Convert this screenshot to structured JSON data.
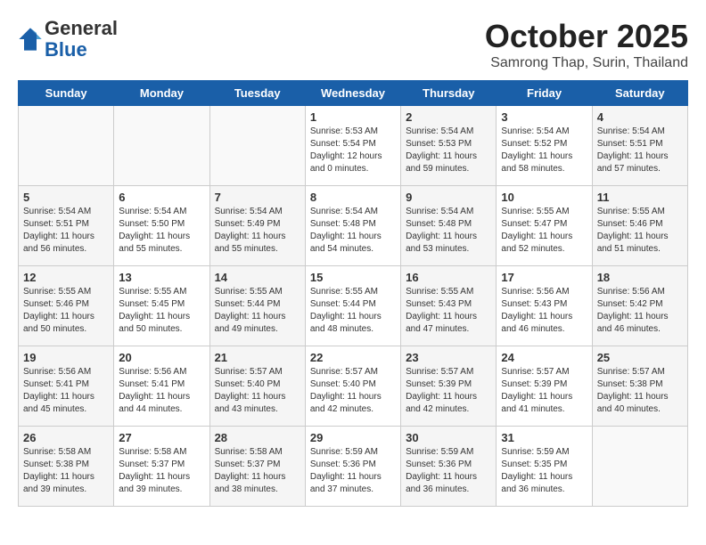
{
  "header": {
    "logo_line1": "General",
    "logo_line2": "Blue",
    "month": "October 2025",
    "location": "Samrong Thap, Surin, Thailand"
  },
  "weekdays": [
    "Sunday",
    "Monday",
    "Tuesday",
    "Wednesday",
    "Thursday",
    "Friday",
    "Saturday"
  ],
  "weeks": [
    [
      {
        "num": "",
        "info": ""
      },
      {
        "num": "",
        "info": ""
      },
      {
        "num": "",
        "info": ""
      },
      {
        "num": "1",
        "info": "Sunrise: 5:53 AM\nSunset: 5:54 PM\nDaylight: 12 hours\nand 0 minutes."
      },
      {
        "num": "2",
        "info": "Sunrise: 5:54 AM\nSunset: 5:53 PM\nDaylight: 11 hours\nand 59 minutes."
      },
      {
        "num": "3",
        "info": "Sunrise: 5:54 AM\nSunset: 5:52 PM\nDaylight: 11 hours\nand 58 minutes."
      },
      {
        "num": "4",
        "info": "Sunrise: 5:54 AM\nSunset: 5:51 PM\nDaylight: 11 hours\nand 57 minutes."
      }
    ],
    [
      {
        "num": "5",
        "info": "Sunrise: 5:54 AM\nSunset: 5:51 PM\nDaylight: 11 hours\nand 56 minutes."
      },
      {
        "num": "6",
        "info": "Sunrise: 5:54 AM\nSunset: 5:50 PM\nDaylight: 11 hours\nand 55 minutes."
      },
      {
        "num": "7",
        "info": "Sunrise: 5:54 AM\nSunset: 5:49 PM\nDaylight: 11 hours\nand 55 minutes."
      },
      {
        "num": "8",
        "info": "Sunrise: 5:54 AM\nSunset: 5:48 PM\nDaylight: 11 hours\nand 54 minutes."
      },
      {
        "num": "9",
        "info": "Sunrise: 5:54 AM\nSunset: 5:48 PM\nDaylight: 11 hours\nand 53 minutes."
      },
      {
        "num": "10",
        "info": "Sunrise: 5:55 AM\nSunset: 5:47 PM\nDaylight: 11 hours\nand 52 minutes."
      },
      {
        "num": "11",
        "info": "Sunrise: 5:55 AM\nSunset: 5:46 PM\nDaylight: 11 hours\nand 51 minutes."
      }
    ],
    [
      {
        "num": "12",
        "info": "Sunrise: 5:55 AM\nSunset: 5:46 PM\nDaylight: 11 hours\nand 50 minutes."
      },
      {
        "num": "13",
        "info": "Sunrise: 5:55 AM\nSunset: 5:45 PM\nDaylight: 11 hours\nand 50 minutes."
      },
      {
        "num": "14",
        "info": "Sunrise: 5:55 AM\nSunset: 5:44 PM\nDaylight: 11 hours\nand 49 minutes."
      },
      {
        "num": "15",
        "info": "Sunrise: 5:55 AM\nSunset: 5:44 PM\nDaylight: 11 hours\nand 48 minutes."
      },
      {
        "num": "16",
        "info": "Sunrise: 5:55 AM\nSunset: 5:43 PM\nDaylight: 11 hours\nand 47 minutes."
      },
      {
        "num": "17",
        "info": "Sunrise: 5:56 AM\nSunset: 5:43 PM\nDaylight: 11 hours\nand 46 minutes."
      },
      {
        "num": "18",
        "info": "Sunrise: 5:56 AM\nSunset: 5:42 PM\nDaylight: 11 hours\nand 46 minutes."
      }
    ],
    [
      {
        "num": "19",
        "info": "Sunrise: 5:56 AM\nSunset: 5:41 PM\nDaylight: 11 hours\nand 45 minutes."
      },
      {
        "num": "20",
        "info": "Sunrise: 5:56 AM\nSunset: 5:41 PM\nDaylight: 11 hours\nand 44 minutes."
      },
      {
        "num": "21",
        "info": "Sunrise: 5:57 AM\nSunset: 5:40 PM\nDaylight: 11 hours\nand 43 minutes."
      },
      {
        "num": "22",
        "info": "Sunrise: 5:57 AM\nSunset: 5:40 PM\nDaylight: 11 hours\nand 42 minutes."
      },
      {
        "num": "23",
        "info": "Sunrise: 5:57 AM\nSunset: 5:39 PM\nDaylight: 11 hours\nand 42 minutes."
      },
      {
        "num": "24",
        "info": "Sunrise: 5:57 AM\nSunset: 5:39 PM\nDaylight: 11 hours\nand 41 minutes."
      },
      {
        "num": "25",
        "info": "Sunrise: 5:57 AM\nSunset: 5:38 PM\nDaylight: 11 hours\nand 40 minutes."
      }
    ],
    [
      {
        "num": "26",
        "info": "Sunrise: 5:58 AM\nSunset: 5:38 PM\nDaylight: 11 hours\nand 39 minutes."
      },
      {
        "num": "27",
        "info": "Sunrise: 5:58 AM\nSunset: 5:37 PM\nDaylight: 11 hours\nand 39 minutes."
      },
      {
        "num": "28",
        "info": "Sunrise: 5:58 AM\nSunset: 5:37 PM\nDaylight: 11 hours\nand 38 minutes."
      },
      {
        "num": "29",
        "info": "Sunrise: 5:59 AM\nSunset: 5:36 PM\nDaylight: 11 hours\nand 37 minutes."
      },
      {
        "num": "30",
        "info": "Sunrise: 5:59 AM\nSunset: 5:36 PM\nDaylight: 11 hours\nand 36 minutes."
      },
      {
        "num": "31",
        "info": "Sunrise: 5:59 AM\nSunset: 5:35 PM\nDaylight: 11 hours\nand 36 minutes."
      },
      {
        "num": "",
        "info": ""
      }
    ]
  ]
}
